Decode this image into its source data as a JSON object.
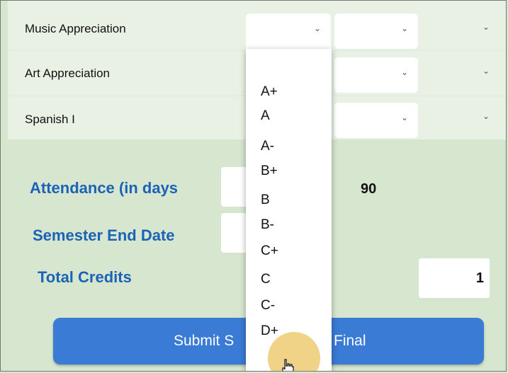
{
  "courses": [
    {
      "name": "Music Appreciation"
    },
    {
      "name": "Art Appreciation"
    },
    {
      "name": "Spanish I"
    }
  ],
  "attendance": {
    "label": "Attendance (in days",
    "value": "90"
  },
  "semester_end": {
    "label": "Semester End Date"
  },
  "total_credits": {
    "label": "Total Credits",
    "value": "1"
  },
  "submit": {
    "label_left": "Submit S",
    "label_right": "Final"
  },
  "grade_dropdown": {
    "options": [
      "A+",
      "A",
      "A-",
      "B+",
      "B",
      "B-",
      "C+",
      "C",
      "C-",
      "D+"
    ]
  },
  "icons": {
    "chevron": "chevron-down-icon",
    "cursor": "hand-pointer-icon"
  },
  "colors": {
    "accent": "#3a7bd5",
    "label_blue": "#1c63b7",
    "panel_bg": "#d6e6cf"
  }
}
